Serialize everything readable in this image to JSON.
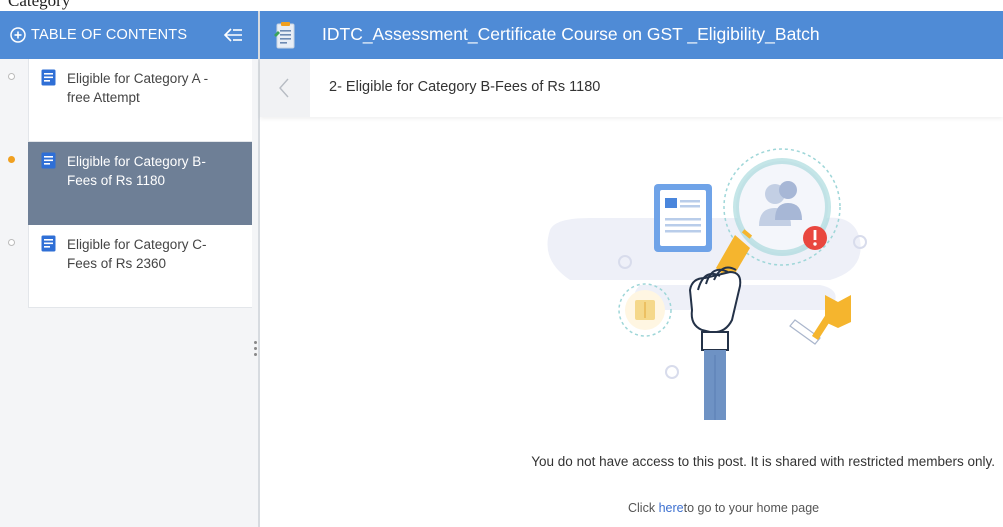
{
  "top_strip_text": "Category",
  "sidebar": {
    "title": "TABLE OF CONTENTS",
    "items": [
      {
        "label": "Eligible for Category A -free Attempt",
        "active": false
      },
      {
        "label": "Eligible for Category B-Fees of Rs 1180",
        "active": true
      },
      {
        "label": "Eligible for Category C-Fees of Rs 2360",
        "active": false
      }
    ]
  },
  "header": {
    "course_title": "IDTC_Assessment_Certificate Course on GST _Eligibility_Batch"
  },
  "post": {
    "title": "2- Eligible for Category B-Fees of Rs 1180"
  },
  "message": {
    "restricted": "You do not have access to this post. It is shared with restricted members only.",
    "home_prefix": "Click ",
    "home_link": "here",
    "home_suffix": "to go to your home page"
  },
  "colors": {
    "header_blue": "#4f8bd6",
    "active_item": "#6e7f96",
    "link": "#3b6fd0",
    "accent_orange": "#f0a020",
    "alert_red": "#e9473f"
  },
  "icons": [
    "plus-circle-icon",
    "collapse-sidebar-icon",
    "document-icon",
    "course-clipboard-icon",
    "chevron-left-icon"
  ]
}
